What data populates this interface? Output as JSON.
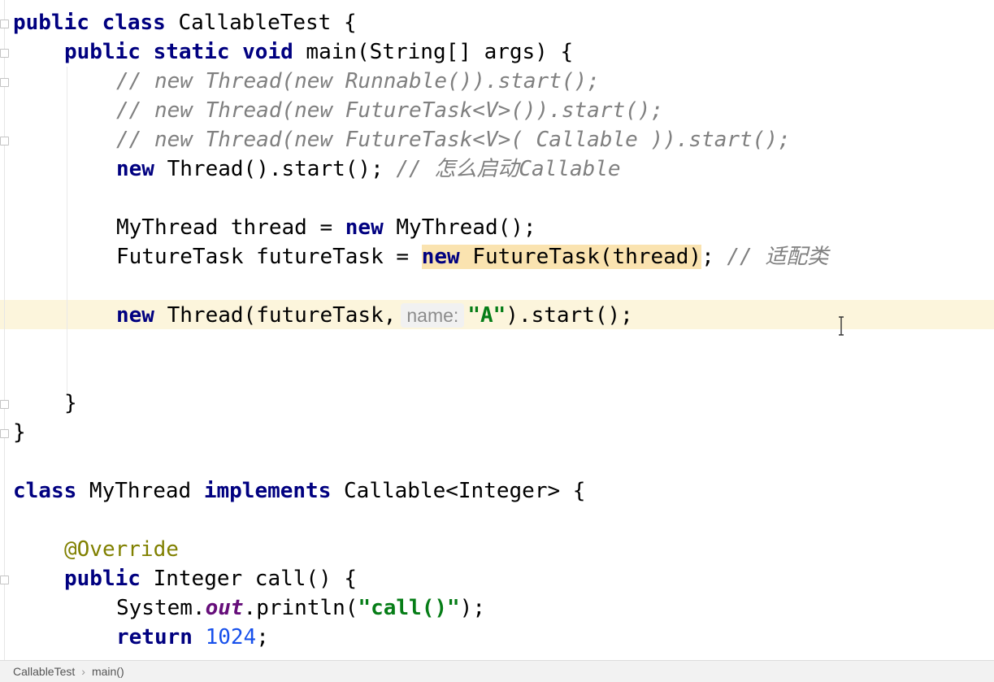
{
  "editor": {
    "lines": {
      "l1": {
        "a": "public class",
        "b": " CallableTest {"
      },
      "l2": {
        "a": "public static void",
        "b": " main(String[] args) {"
      },
      "l3": {
        "c": "// new Thread(new Runnable()).start();"
      },
      "l4": {
        "c": "// new Thread(new FutureTask<V>()).start();"
      },
      "l5": {
        "c": "// new Thread(new FutureTask<V>( Callable )).start();"
      },
      "l6": {
        "a": "new",
        "b": " Thread().start(); ",
        "c": "// 怎么启动Callable"
      },
      "l8": {
        "a": "MyThread thread = ",
        "b": "new",
        "c": " MyThread();"
      },
      "l9": {
        "a": "FutureTask futureTask = ",
        "b": "new",
        "c": " FutureTask(thread)",
        "d": "; ",
        "e": "// 适配类"
      },
      "l11": {
        "a": "new",
        "b": " Thread(futureTask,",
        "hint": "name:",
        "s": "\"A\"",
        "c": ").start();"
      },
      "l14": {
        "a": "}"
      },
      "l15": {
        "a": "}"
      },
      "l17": {
        "a": "class",
        "b": " MyThread ",
        "c": "implements",
        "d": " Callable<Integer> {"
      },
      "l19": {
        "a": "@Override"
      },
      "l20": {
        "a": "public",
        "b": " Integer call() {"
      },
      "l21": {
        "a": "System.",
        "f": "out",
        "b": ".println(",
        "s": "\"call()\"",
        "c": ");"
      },
      "l22": {
        "a": "return",
        "sp": " ",
        "n": "1024",
        "c": ";"
      }
    }
  },
  "statusbar": {
    "crumb1": "CallableTest",
    "sep": "›",
    "crumb2": "main()"
  }
}
